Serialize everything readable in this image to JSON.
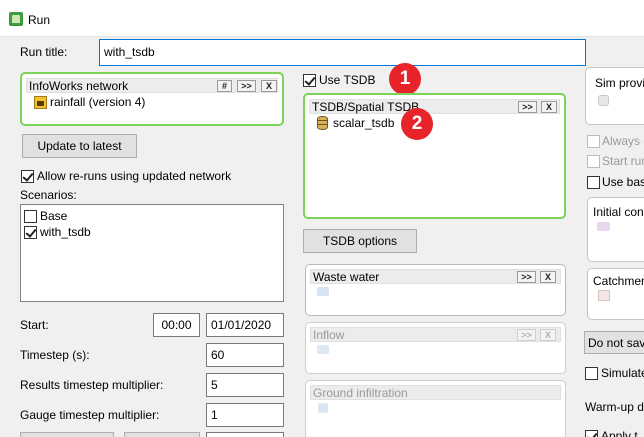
{
  "window": {
    "title": "Run"
  },
  "run_title": {
    "label": "Run title:",
    "value": "with_tsdb"
  },
  "network": {
    "title": "InfoWorks network",
    "btn_hash": "#",
    "btn_more": ">>",
    "btn_close": "X",
    "item": "rainfall (version 4)"
  },
  "update_btn": "Update to latest",
  "allow_reruns": "Allow re-runs using updated network",
  "scenarios": {
    "label": "Scenarios:",
    "items": [
      {
        "label": "Base",
        "checked": false
      },
      {
        "label": "with_tsdb",
        "checked": true
      }
    ]
  },
  "start": {
    "label": "Start:",
    "time": "00:00",
    "date": "01/01/2020"
  },
  "timestep": {
    "label": "Timestep (s):",
    "value": "60"
  },
  "results_mult": {
    "label": "Results timestep multiplier:",
    "value": "5"
  },
  "gauge_mult": {
    "label": "Gauge timestep multiplier:",
    "value": "1"
  },
  "use_tsdb": {
    "label": "Use TSDB"
  },
  "tsdb": {
    "title": "TSDB/Spatial TSDB",
    "btn_more": ">>",
    "btn_close": "X",
    "item": "scalar_tsdb"
  },
  "tsdb_options_btn": "TSDB options",
  "waste_water": {
    "title": "Waste water",
    "btn_more": ">>",
    "btn_close": "X"
  },
  "inflow": {
    "title": "Inflow",
    "btn_more": ">>",
    "btn_close": "X"
  },
  "ground_infiltration": {
    "title": "Ground infiltration"
  },
  "badges": {
    "one": "1",
    "two": "2"
  },
  "right": {
    "sim_prov": "Sim provi",
    "always": "Always c",
    "start_run": "Start run",
    "use_base": "Use base",
    "initial_cond": "Initial con",
    "catchment": "Catchmen",
    "do_not_save": "Do not sav",
    "simulate": "Simulate",
    "warmup": "Warm-up d",
    "apply": "Apply t"
  },
  "colors": {
    "green_border": "#7bd35a",
    "badge": "#e8232a",
    "focus_border": "#0078d7"
  }
}
